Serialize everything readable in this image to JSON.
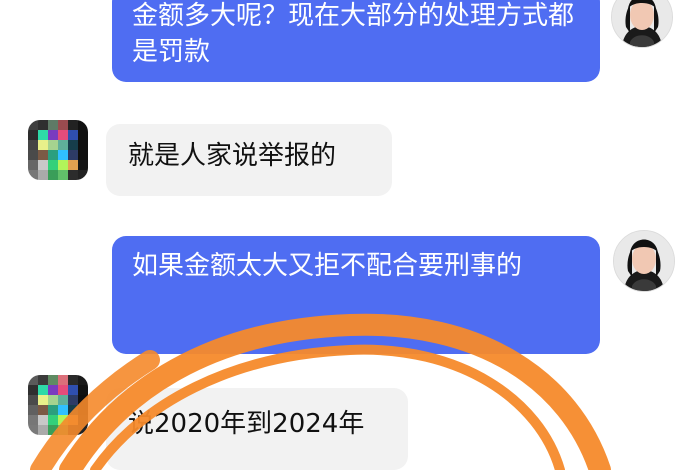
{
  "messages": {
    "m1": "金额多大呢？现在大部分的处理方式都是罚款",
    "m2": "就是人家说举报的",
    "m3": "如果金额太大又拒不配合要刑事的",
    "m4": "说2020年到2024年"
  },
  "colors": {
    "outgoing_bubble": "#4f6df2",
    "incoming_bubble": "#f2f2f2",
    "annotation_ink": "#f58a2b"
  },
  "icons": {
    "agent_avatar": "woman-portrait-icon",
    "user_avatar": "pixelated-avatar-icon"
  }
}
